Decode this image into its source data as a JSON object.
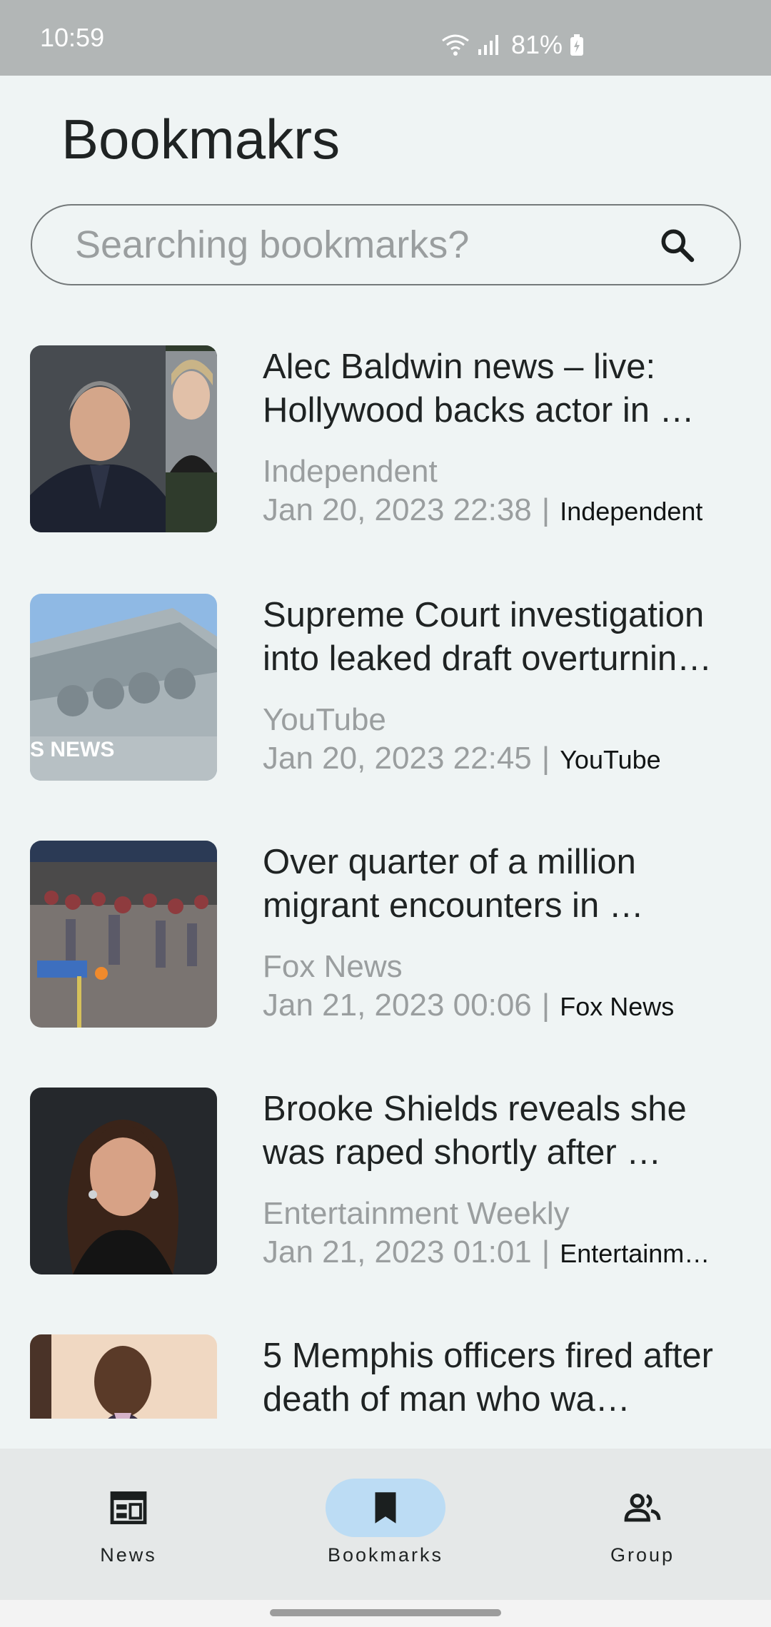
{
  "status_bar": {
    "time": "10:59",
    "battery": "81%"
  },
  "page": {
    "title": "Bookmakrs"
  },
  "search": {
    "placeholder": "Searching bookmarks?",
    "value": ""
  },
  "bookmarks": [
    {
      "title": "Alec Baldwin news – live: Hollywood backs actor in …",
      "source": "Independent",
      "date": "Jan 20, 2023 22:38",
      "separator": "|",
      "publisher": "Independent",
      "thumb": "portrait-man-suit"
    },
    {
      "title": "Supreme Court investigation into leaked draft overturnin…",
      "source": "YouTube",
      "date": "Jan 20, 2023 22:45",
      "separator": "|",
      "publisher": "YouTube",
      "thumb": "court-facade",
      "thumb_caption": "S NEWS"
    },
    {
      "title": "Over quarter of a million migrant encounters in …",
      "source": "Fox News",
      "date": "Jan 21, 2023 00:06",
      "separator": "|",
      "publisher": "Fox News",
      "thumb": "crowd-night"
    },
    {
      "title": "Brooke Shields reveals she was raped shortly after …",
      "source": "Entertainment Weekly",
      "date": "Jan 21, 2023 01:01",
      "separator": "|",
      "publisher": "Entertainme…",
      "thumb": "portrait-woman"
    },
    {
      "title": "5 Memphis officers fired after death of man who wa…",
      "source": "",
      "date": "",
      "separator": "",
      "publisher": "",
      "thumb": "portrait-man-smile"
    }
  ],
  "nav": {
    "items": [
      {
        "label": "News",
        "icon": "newspaper-icon",
        "active": false
      },
      {
        "label": "Bookmarks",
        "icon": "bookmark-icon",
        "active": true
      },
      {
        "label": "Group",
        "icon": "group-icon",
        "active": false
      }
    ]
  },
  "colors": {
    "background": "#eff4f4",
    "status_bar": "#b2b6b6",
    "accent": "#bcdcf4",
    "nav_background": "#e5e8e8",
    "muted_text": "#9a9e9f"
  }
}
